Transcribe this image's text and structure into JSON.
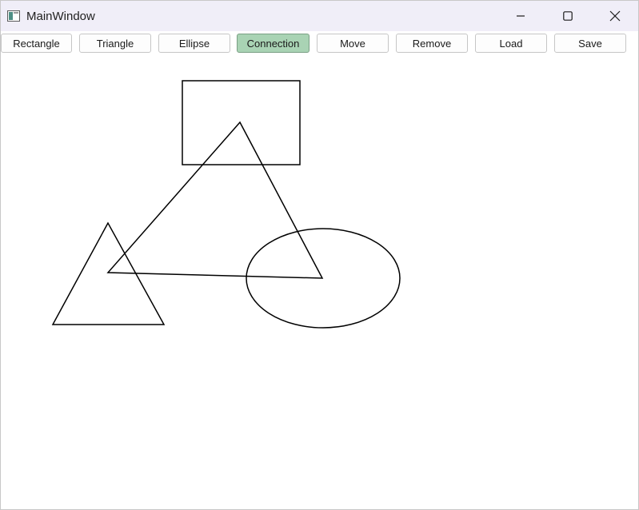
{
  "window": {
    "title": "MainWindow",
    "app_icon": "app-window-icon"
  },
  "titlebar_controls": [
    {
      "name": "minimize",
      "icon": "minimize-icon"
    },
    {
      "name": "maximize",
      "icon": "maximize-icon"
    },
    {
      "name": "close",
      "icon": "close-icon"
    }
  ],
  "toolbar": {
    "rectangle": "Rectangle",
    "triangle": "Triangle",
    "ellipse": "Ellipse",
    "connection": "Connection",
    "move": "Move",
    "remove": "Remove",
    "load": "Load",
    "save": "Save",
    "active_tool": "Connection",
    "active_color": "#a9d3b4"
  },
  "canvas": {
    "shapes": [
      {
        "type": "rectangle"
      },
      {
        "type": "triangle"
      },
      {
        "type": "triangle"
      },
      {
        "type": "ellipse"
      }
    ],
    "connection_count": 1
  }
}
